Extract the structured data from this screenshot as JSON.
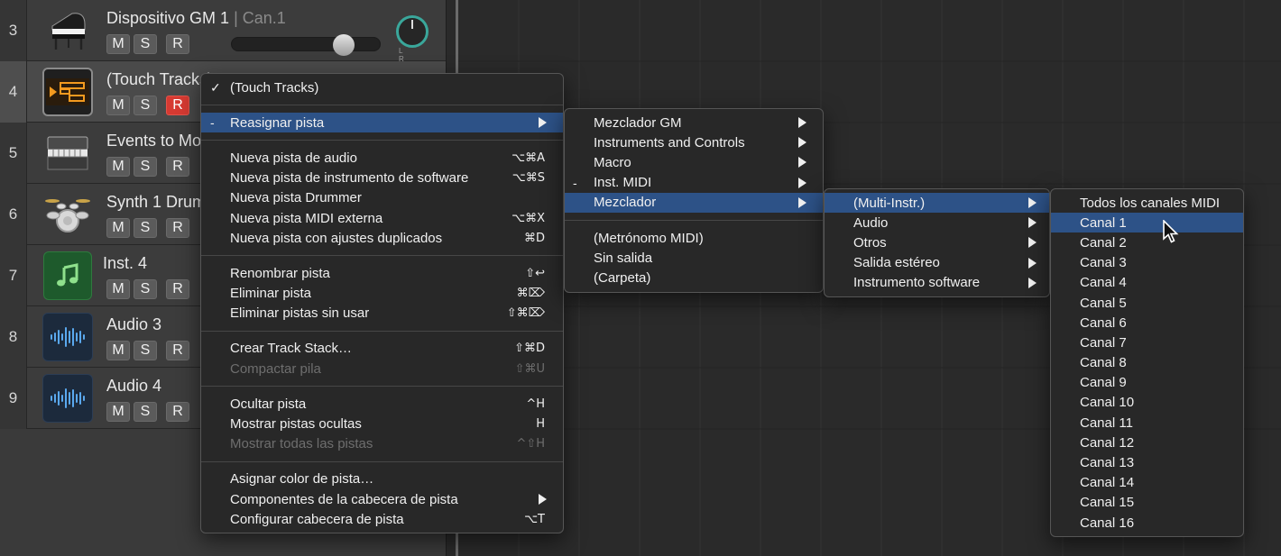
{
  "tracks": [
    {
      "number": "3",
      "name": "Dispositivo GM 1",
      "channel": "| Can.1",
      "icon": "grand-piano-icon",
      "buttons": [
        "M",
        "S",
        "R"
      ],
      "record_armed": false
    },
    {
      "number": "4",
      "name": "(Touch Tracks)",
      "icon": "touch-tracks-icon",
      "buttons": [
        "M",
        "S",
        "R"
      ],
      "record_armed": true
    },
    {
      "number": "5",
      "name": "Events to Mo",
      "icon": "electric-piano-icon",
      "buttons": [
        "M",
        "S",
        "R"
      ],
      "record_armed": false
    },
    {
      "number": "6",
      "name": "Synth 1 Drum",
      "icon": "drum-kit-icon",
      "buttons": [
        "M",
        "S",
        "R"
      ],
      "record_armed": false
    },
    {
      "number": "7",
      "name": "Inst. 4",
      "icon": "music-note-icon",
      "buttons": [
        "M",
        "S",
        "R"
      ],
      "record_armed": false
    },
    {
      "number": "8",
      "name": "Audio 3",
      "icon": "waveform-icon",
      "buttons": [
        "M",
        "S",
        "R"
      ],
      "record_armed": false
    },
    {
      "number": "9",
      "name": "Audio 4",
      "icon": "waveform-icon",
      "buttons": [
        "M",
        "S",
        "R"
      ],
      "record_armed": false
    }
  ],
  "pan_labels": "L R",
  "context_menu": {
    "items": [
      {
        "label": "(Touch Tracks)",
        "mark": "✓"
      },
      {
        "sep": true
      },
      {
        "label": "Reasignar pista",
        "mark": "-",
        "submenu": true,
        "highlighted": true
      },
      {
        "sep": true
      },
      {
        "label": "Nueva pista de audio",
        "shortcut": "⌥⌘A"
      },
      {
        "label": "Nueva pista de instrumento de software",
        "shortcut": "⌥⌘S"
      },
      {
        "label": "Nueva pista Drummer"
      },
      {
        "label": "Nueva pista MIDI externa",
        "shortcut": "⌥⌘X"
      },
      {
        "label": "Nueva pista con ajustes duplicados",
        "shortcut": "⌘D"
      },
      {
        "sep": true
      },
      {
        "label": "Renombrar pista",
        "shortcut": "⇧↩"
      },
      {
        "label": "Eliminar pista",
        "shortcut": "⌘⌦"
      },
      {
        "label": "Eliminar pistas sin usar",
        "shortcut": "⇧⌘⌦"
      },
      {
        "sep": true
      },
      {
        "label": "Crear Track Stack…",
        "shortcut": "⇧⌘D"
      },
      {
        "label": "Compactar pila",
        "shortcut": "⇧⌘U",
        "disabled": true
      },
      {
        "sep": true
      },
      {
        "label": "Ocultar pista",
        "shortcut": "^H"
      },
      {
        "label": "Mostrar pistas ocultas",
        "shortcut": "H"
      },
      {
        "label": "Mostrar todas las pistas",
        "shortcut": "^⇧H",
        "disabled": true
      },
      {
        "sep": true
      },
      {
        "label": "Asignar color de pista…"
      },
      {
        "label": "Componentes de la cabecera de pista",
        "submenu": true
      },
      {
        "label": "Configurar cabecera de pista",
        "shortcut": "⌥T"
      }
    ]
  },
  "submenu_reassign": {
    "items": [
      {
        "label": "Mezclador GM",
        "submenu": true
      },
      {
        "label": "Instruments and Controls",
        "submenu": true
      },
      {
        "label": "Macro",
        "submenu": true
      },
      {
        "label": "Inst. MIDI",
        "mark": "-",
        "submenu": true
      },
      {
        "label": "Mezclador",
        "submenu": true,
        "highlighted": true
      },
      {
        "sep": true
      },
      {
        "label": "(Metrónomo MIDI)"
      },
      {
        "label": "Sin salida"
      },
      {
        "label": "(Carpeta)"
      }
    ]
  },
  "submenu_mixer": {
    "items": [
      {
        "label": "(Multi-Instr.)",
        "submenu": true,
        "highlighted": true
      },
      {
        "label": "Audio",
        "submenu": true
      },
      {
        "label": "Otros",
        "submenu": true
      },
      {
        "label": "Salida estéreo",
        "submenu": true
      },
      {
        "label": "Instrumento software",
        "submenu": true
      }
    ]
  },
  "submenu_channels": {
    "items": [
      {
        "label": "Todos los canales MIDI"
      },
      {
        "label": "Canal 1",
        "highlighted": true
      },
      {
        "label": "Canal 2"
      },
      {
        "label": "Canal 3"
      },
      {
        "label": "Canal 4"
      },
      {
        "label": "Canal 5"
      },
      {
        "label": "Canal 6"
      },
      {
        "label": "Canal 7"
      },
      {
        "label": "Canal 8"
      },
      {
        "label": "Canal 9"
      },
      {
        "label": "Canal 10"
      },
      {
        "label": "Canal 11"
      },
      {
        "label": "Canal 12"
      },
      {
        "label": "Canal 13"
      },
      {
        "label": "Canal 14"
      },
      {
        "label": "Canal 15"
      },
      {
        "label": "Canal 16"
      }
    ]
  },
  "colors": {
    "highlight": "#2d5287",
    "record": "#d63a32",
    "pan_knob_ring": "#3aa79b"
  }
}
